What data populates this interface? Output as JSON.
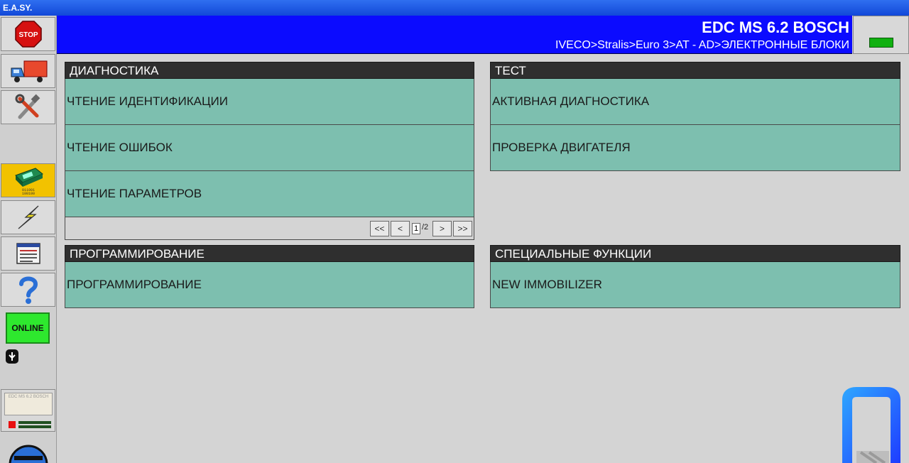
{
  "window": {
    "title": "E.A.SY."
  },
  "sidebar": {
    "stop_label": "STOP",
    "online_label": "ONLINE",
    "mini_screen_text": "EDC MS 6.2 BOSCH",
    "icons": [
      "stop-icon",
      "truck-icon",
      "tools-icon",
      "ecu-icon",
      "lightning-icon",
      "list-icon",
      "help-icon",
      "usb-icon"
    ],
    "colors": {
      "active": "#f2c200",
      "online": "#2ee82e"
    }
  },
  "header": {
    "title": "EDC MS 6.2 BOSCH",
    "breadcrumb": "IVECO>Stralis>Euro 3>AT - AD>ЭЛЕКТРОННЫЕ БЛОКИ",
    "color": "#0b0bff"
  },
  "panels": {
    "diagnostics": {
      "title": "ДИАГНОСТИКА",
      "items": [
        "ЧТЕНИЕ ИДЕНТИФИКАЦИИ",
        "ЧТЕНИЕ ОШИБОК",
        "ЧТЕНИЕ ПАРАМЕТРОВ"
      ],
      "pager": {
        "first": "<<",
        "prev": "<",
        "page": "1",
        "total": "/2",
        "next": ">",
        "last": ">>"
      }
    },
    "test": {
      "title": "ТЕСТ",
      "items": [
        "АКТИВНАЯ ДИАГНОСТИКА",
        "ПРОВЕРКА ДВИГАТЕЛЯ"
      ]
    },
    "programming": {
      "title": "ПРОГРАММИРОВАНИЕ",
      "items": [
        "ПРОГРАММИРОВАНИЕ"
      ]
    },
    "special": {
      "title": "СПЕЦИАЛЬНЫЕ ФУНКЦИИ",
      "items": [
        "NEW IMMOBILIZER"
      ]
    }
  },
  "colors": {
    "item_bg": "#7dbfaf",
    "panel_head": "#2f2f2f"
  }
}
